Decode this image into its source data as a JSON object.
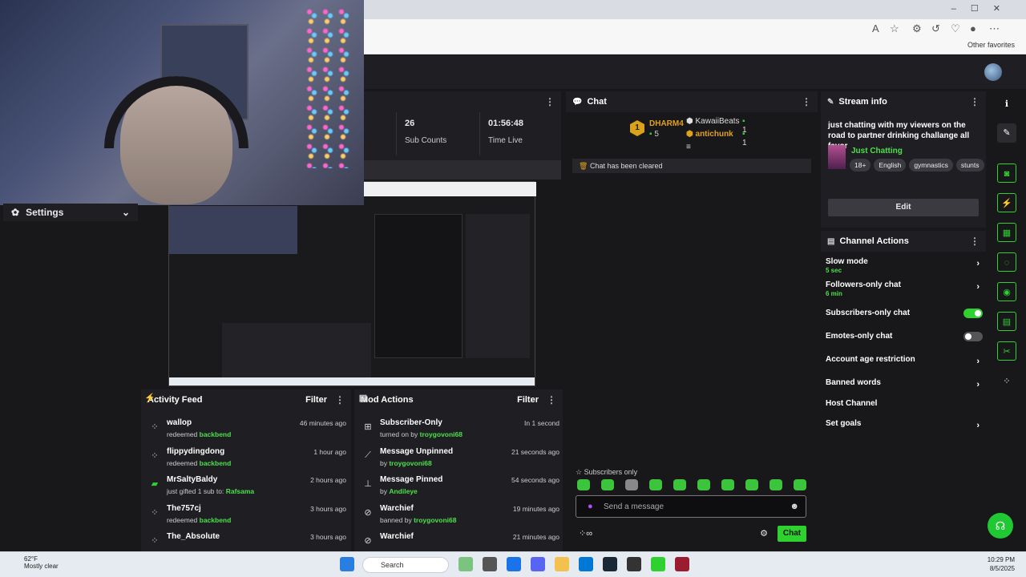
{
  "browser": {
    "other_favorites": "Other favorites"
  },
  "webcam": {
    "label": "webcam-feed"
  },
  "settings": {
    "label": "Settings"
  },
  "stats": {
    "sub_count_value": "26",
    "sub_count_label": "Sub Counts",
    "time_live_value": "01:56:48",
    "time_live_label": "Time Live"
  },
  "chat": {
    "title": "Chat",
    "leaders": [
      {
        "rank": "1",
        "name": "DHARM4",
        "count": "5"
      },
      {
        "name": "KawaiiBeats",
        "count": "1"
      },
      {
        "name": "antichunk",
        "count": "1"
      }
    ],
    "cleared_text": "Chat has been cleared",
    "mode_text": "Subscribers only",
    "input_placeholder": "Send a message",
    "send_label": "Chat"
  },
  "stream_info": {
    "header": "Stream info",
    "title": "just chatting with my viewers on the road to partner drinking challange all favor",
    "category": "Just Chatting",
    "tags": [
      "18+",
      "English",
      "gymnastics",
      "stunts"
    ],
    "edit_label": "Edit"
  },
  "channel_actions": {
    "header": "Channel Actions",
    "items": [
      {
        "label": "Slow mode",
        "sub": "5 sec"
      },
      {
        "label": "Followers-only chat",
        "sub": "6 min"
      },
      {
        "label": "Subscribers-only chat",
        "toggle": "on"
      },
      {
        "label": "Emotes-only chat",
        "toggle": "off"
      },
      {
        "label": "Account age restriction"
      },
      {
        "label": "Banned words"
      },
      {
        "label": "Host Channel"
      },
      {
        "label": "Set goals"
      }
    ]
  },
  "activity_feed": {
    "title": "Activity Feed",
    "filter": "Filter",
    "rows": [
      {
        "name": "wallop",
        "pre": "redeemed ",
        "hl": "backbend",
        "post": "",
        "time": "46 minutes ago"
      },
      {
        "name": "flippydingdong",
        "pre": "redeemed ",
        "hl": "backbend",
        "post": "",
        "time": "1 hour ago"
      },
      {
        "name": "MrSaltyBaldy",
        "pre": "just gifted 1 sub to: ",
        "hl": "Rafsama",
        "post": "",
        "time": "2 hours ago"
      },
      {
        "name": "The757cj",
        "pre": "redeemed ",
        "hl": "backbend",
        "post": "",
        "time": "3 hours ago"
      },
      {
        "name": "The_Absolute",
        "pre": "",
        "hl": "",
        "post": "",
        "time": "3 hours ago"
      }
    ]
  },
  "mod_actions": {
    "title": "Mod Actions",
    "filter": "Filter",
    "rows": [
      {
        "name": "Subscriber-Only",
        "pre": "turned on by ",
        "hl": "troygovoni68",
        "time": "In 1 second"
      },
      {
        "name": "Message Unpinned",
        "pre": "by ",
        "hl": "troygovoni68",
        "time": "21 seconds ago"
      },
      {
        "name": "Message Pinned",
        "pre": "by ",
        "hl": "Andileye",
        "time": "54 seconds ago"
      },
      {
        "name": "Warchief",
        "pre": "banned by ",
        "hl": "troygovoni68",
        "time": "19 minutes ago"
      },
      {
        "name": "Warchief",
        "pre": "",
        "hl": "",
        "time": "21 minutes ago"
      }
    ]
  },
  "taskbar": {
    "weather_temp": "62°F",
    "weather_desc": "Mostly clear",
    "search": "Search",
    "time": "10:29 PM",
    "date": "8/5/2025"
  },
  "colors": {
    "accent": "#2fd12f",
    "panel": "#1f1f23",
    "bg": "#18181b"
  }
}
